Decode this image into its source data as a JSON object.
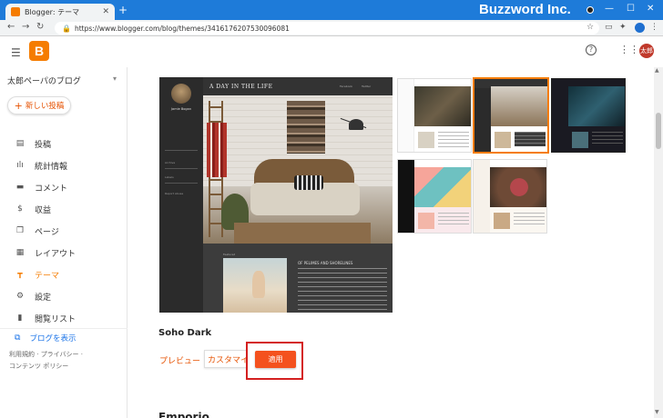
{
  "browser": {
    "tab_title": "Blogger: テーマ",
    "new_tab": "+",
    "url": "https://www.blogger.com/blog/themes/3416176207530096081",
    "brand_overlay": "Buzzword Inc."
  },
  "header": {
    "logo_letter": "B",
    "help": "?",
    "user_avatar_text": "太郎"
  },
  "sidebar": {
    "blog_name": "太郎ペーパのブログ",
    "new_post_label": "新しい投稿",
    "items": [
      {
        "label": "投稿",
        "icon": "posts-icon"
      },
      {
        "label": "統計情報",
        "icon": "stats-icon"
      },
      {
        "label": "コメント",
        "icon": "comments-icon"
      },
      {
        "label": "収益",
        "icon": "earnings-icon"
      },
      {
        "label": "ページ",
        "icon": "pages-icon"
      },
      {
        "label": "レイアウト",
        "icon": "layout-icon"
      },
      {
        "label": "テーマ",
        "icon": "theme-icon",
        "active": true
      },
      {
        "label": "設定",
        "icon": "settings-icon"
      },
      {
        "label": "閲覧リスト",
        "icon": "reading-list-icon"
      }
    ],
    "view_blog_label": "ブログを表示",
    "footer_links": [
      "利用規約",
      "プライバシー",
      "コンテンツ ポリシー"
    ]
  },
  "main": {
    "preview": {
      "title": "A DAY IN THE LIFE",
      "author": "Jamie Bogan",
      "nav_links": [
        "Facebook",
        "Twitter"
      ],
      "side_items": [
        "Archive",
        "Labels",
        "Report Abuse"
      ],
      "post_title": "OF PELIMES AND SHORELINES",
      "section_label": "Featured"
    },
    "theme_name": "Soho Dark",
    "preview_link": "プレビュー",
    "customize_label": "カスタマイズ",
    "apply_label": "適用",
    "next_section_heading": "Emporio"
  },
  "colors": {
    "accent": "#f57c00",
    "apply_button": "#f4511e",
    "highlight_box": "#d42020",
    "tab_strip": "#1e7bd9"
  }
}
